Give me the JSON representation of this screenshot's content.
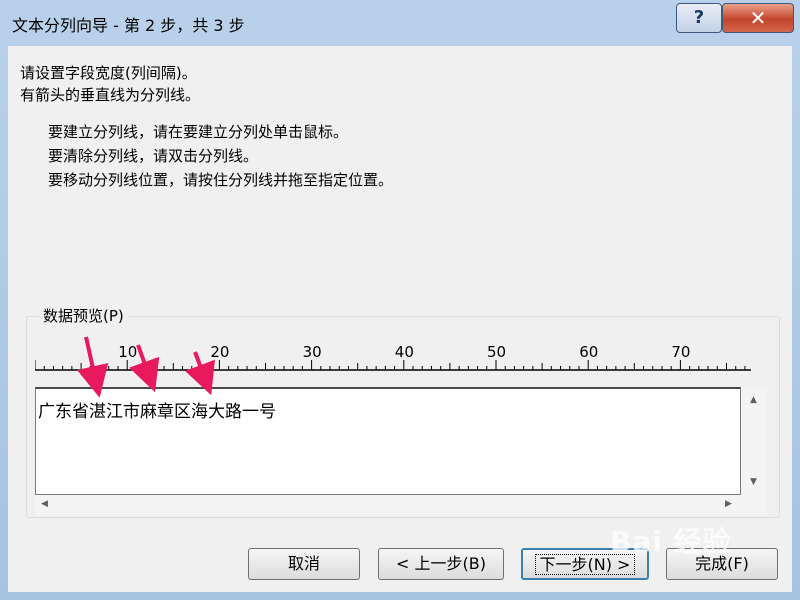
{
  "window": {
    "title": "文本分列向导 - 第 2 步，共 3 步",
    "help_label": "?",
    "close_label": "✕"
  },
  "instructions": {
    "line1": "请设置字段宽度(列间隔)。",
    "line2": "有箭头的垂直线为分列线。",
    "hint1": "要建立分列线，请在要建立分列处单击鼠标。",
    "hint2": "要清除分列线，请双击分列线。",
    "hint3": "要移动分列线位置，请按住分列线并拖至指定位置。"
  },
  "preview": {
    "label": "数据预览(P)",
    "ruler_ticks": [
      "10",
      "20",
      "30",
      "40",
      "50",
      "60",
      "70"
    ],
    "rows": [
      "广东省湛江市麻章区海大路一号"
    ]
  },
  "buttons": {
    "cancel": "取消",
    "back": "< 上一步(B)",
    "next": "下一步(N) >",
    "finish": "完成(F)"
  },
  "watermark": "Bai 经验",
  "colors": {
    "annotation_arrow": "#e8195c",
    "accent": "#3c7fb1"
  }
}
